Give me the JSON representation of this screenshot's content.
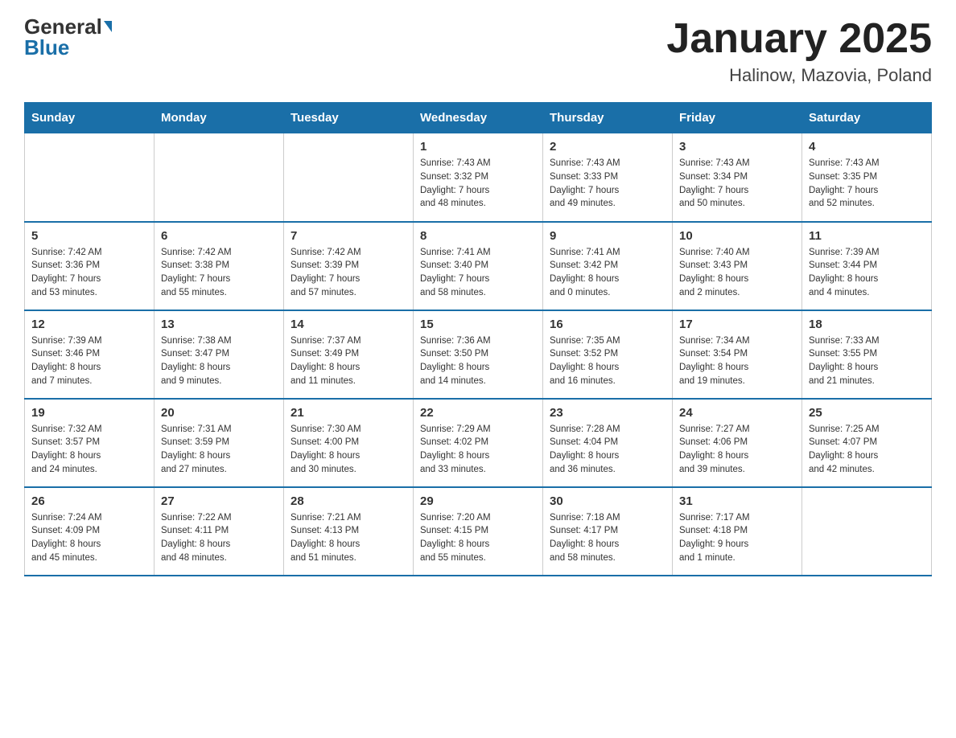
{
  "header": {
    "logo_general": "General",
    "logo_blue": "Blue",
    "title": "January 2025",
    "subtitle": "Halinow, Mazovia, Poland"
  },
  "weekdays": [
    "Sunday",
    "Monday",
    "Tuesday",
    "Wednesday",
    "Thursday",
    "Friday",
    "Saturday"
  ],
  "weeks": [
    [
      {
        "day": "",
        "info": ""
      },
      {
        "day": "",
        "info": ""
      },
      {
        "day": "",
        "info": ""
      },
      {
        "day": "1",
        "info": "Sunrise: 7:43 AM\nSunset: 3:32 PM\nDaylight: 7 hours\nand 48 minutes."
      },
      {
        "day": "2",
        "info": "Sunrise: 7:43 AM\nSunset: 3:33 PM\nDaylight: 7 hours\nand 49 minutes."
      },
      {
        "day": "3",
        "info": "Sunrise: 7:43 AM\nSunset: 3:34 PM\nDaylight: 7 hours\nand 50 minutes."
      },
      {
        "day": "4",
        "info": "Sunrise: 7:43 AM\nSunset: 3:35 PM\nDaylight: 7 hours\nand 52 minutes."
      }
    ],
    [
      {
        "day": "5",
        "info": "Sunrise: 7:42 AM\nSunset: 3:36 PM\nDaylight: 7 hours\nand 53 minutes."
      },
      {
        "day": "6",
        "info": "Sunrise: 7:42 AM\nSunset: 3:38 PM\nDaylight: 7 hours\nand 55 minutes."
      },
      {
        "day": "7",
        "info": "Sunrise: 7:42 AM\nSunset: 3:39 PM\nDaylight: 7 hours\nand 57 minutes."
      },
      {
        "day": "8",
        "info": "Sunrise: 7:41 AM\nSunset: 3:40 PM\nDaylight: 7 hours\nand 58 minutes."
      },
      {
        "day": "9",
        "info": "Sunrise: 7:41 AM\nSunset: 3:42 PM\nDaylight: 8 hours\nand 0 minutes."
      },
      {
        "day": "10",
        "info": "Sunrise: 7:40 AM\nSunset: 3:43 PM\nDaylight: 8 hours\nand 2 minutes."
      },
      {
        "day": "11",
        "info": "Sunrise: 7:39 AM\nSunset: 3:44 PM\nDaylight: 8 hours\nand 4 minutes."
      }
    ],
    [
      {
        "day": "12",
        "info": "Sunrise: 7:39 AM\nSunset: 3:46 PM\nDaylight: 8 hours\nand 7 minutes."
      },
      {
        "day": "13",
        "info": "Sunrise: 7:38 AM\nSunset: 3:47 PM\nDaylight: 8 hours\nand 9 minutes."
      },
      {
        "day": "14",
        "info": "Sunrise: 7:37 AM\nSunset: 3:49 PM\nDaylight: 8 hours\nand 11 minutes."
      },
      {
        "day": "15",
        "info": "Sunrise: 7:36 AM\nSunset: 3:50 PM\nDaylight: 8 hours\nand 14 minutes."
      },
      {
        "day": "16",
        "info": "Sunrise: 7:35 AM\nSunset: 3:52 PM\nDaylight: 8 hours\nand 16 minutes."
      },
      {
        "day": "17",
        "info": "Sunrise: 7:34 AM\nSunset: 3:54 PM\nDaylight: 8 hours\nand 19 minutes."
      },
      {
        "day": "18",
        "info": "Sunrise: 7:33 AM\nSunset: 3:55 PM\nDaylight: 8 hours\nand 21 minutes."
      }
    ],
    [
      {
        "day": "19",
        "info": "Sunrise: 7:32 AM\nSunset: 3:57 PM\nDaylight: 8 hours\nand 24 minutes."
      },
      {
        "day": "20",
        "info": "Sunrise: 7:31 AM\nSunset: 3:59 PM\nDaylight: 8 hours\nand 27 minutes."
      },
      {
        "day": "21",
        "info": "Sunrise: 7:30 AM\nSunset: 4:00 PM\nDaylight: 8 hours\nand 30 minutes."
      },
      {
        "day": "22",
        "info": "Sunrise: 7:29 AM\nSunset: 4:02 PM\nDaylight: 8 hours\nand 33 minutes."
      },
      {
        "day": "23",
        "info": "Sunrise: 7:28 AM\nSunset: 4:04 PM\nDaylight: 8 hours\nand 36 minutes."
      },
      {
        "day": "24",
        "info": "Sunrise: 7:27 AM\nSunset: 4:06 PM\nDaylight: 8 hours\nand 39 minutes."
      },
      {
        "day": "25",
        "info": "Sunrise: 7:25 AM\nSunset: 4:07 PM\nDaylight: 8 hours\nand 42 minutes."
      }
    ],
    [
      {
        "day": "26",
        "info": "Sunrise: 7:24 AM\nSunset: 4:09 PM\nDaylight: 8 hours\nand 45 minutes."
      },
      {
        "day": "27",
        "info": "Sunrise: 7:22 AM\nSunset: 4:11 PM\nDaylight: 8 hours\nand 48 minutes."
      },
      {
        "day": "28",
        "info": "Sunrise: 7:21 AM\nSunset: 4:13 PM\nDaylight: 8 hours\nand 51 minutes."
      },
      {
        "day": "29",
        "info": "Sunrise: 7:20 AM\nSunset: 4:15 PM\nDaylight: 8 hours\nand 55 minutes."
      },
      {
        "day": "30",
        "info": "Sunrise: 7:18 AM\nSunset: 4:17 PM\nDaylight: 8 hours\nand 58 minutes."
      },
      {
        "day": "31",
        "info": "Sunrise: 7:17 AM\nSunset: 4:18 PM\nDaylight: 9 hours\nand 1 minute."
      },
      {
        "day": "",
        "info": ""
      }
    ]
  ]
}
